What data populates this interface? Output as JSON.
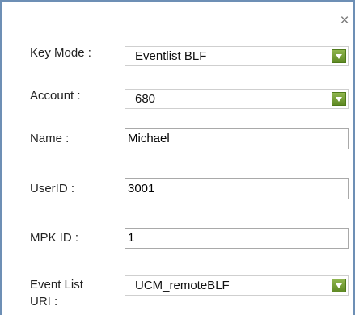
{
  "dialog": {
    "close_icon": "close-icon",
    "close_glyph": "×"
  },
  "fields": {
    "key_mode": {
      "label": "Key Mode :",
      "value": "Eventlist BLF"
    },
    "account": {
      "label": "Account :",
      "value": "680"
    },
    "name": {
      "label": "Name :",
      "value": "Michael"
    },
    "userid": {
      "label": "UserID :",
      "value": "3001"
    },
    "mpk_id": {
      "label": "MPK ID :",
      "value": "1"
    },
    "event_list_uri": {
      "label_line1": "Event List",
      "label_line2": "URI :",
      "value": "UCM_remoteBLF"
    }
  },
  "colors": {
    "border": "#6d8fb5",
    "dropdown_arrow": "#6e9a2e"
  }
}
